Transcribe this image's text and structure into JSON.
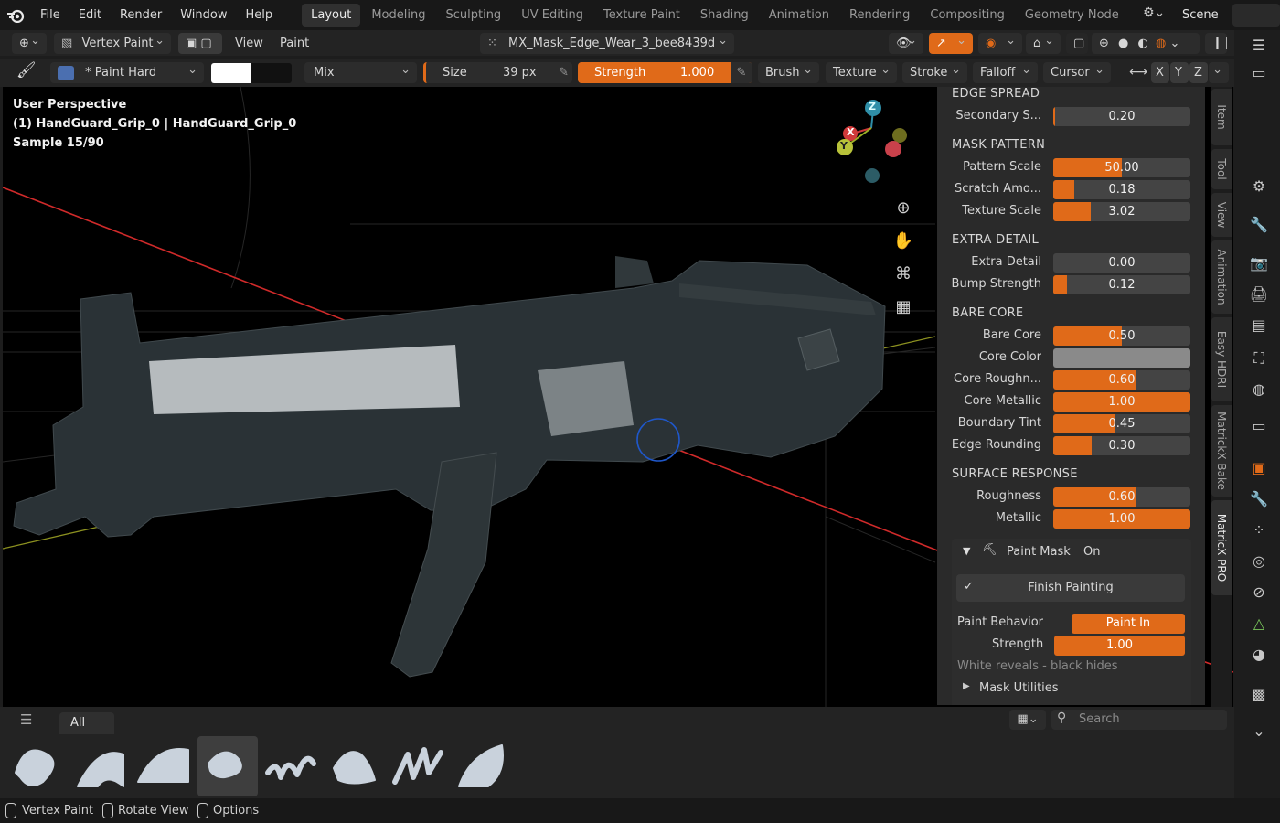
{
  "menu": [
    "File",
    "Edit",
    "Render",
    "Window",
    "Help"
  ],
  "workspaces": [
    {
      "label": "Layout",
      "active": true
    },
    {
      "label": "Modeling",
      "active": false
    },
    {
      "label": "Sculpting",
      "active": false
    },
    {
      "label": "UV Editing",
      "active": false
    },
    {
      "label": "Texture Paint",
      "active": false
    },
    {
      "label": "Shading",
      "active": false
    },
    {
      "label": "Animation",
      "active": false
    },
    {
      "label": "Rendering",
      "active": false
    },
    {
      "label": "Compositing",
      "active": false
    },
    {
      "label": "Geometry Node",
      "active": false
    }
  ],
  "scene": "Scene",
  "header1": {
    "mode": "Vertex Paint",
    "view": "View",
    "paint": "Paint",
    "color_attribute": "MX_Mask_Edge_Wear_3_bee8439d"
  },
  "header2": {
    "brush_name": "* Paint Hard",
    "blend": "Mix",
    "size_label": "Size",
    "size_value": "39 px",
    "strength_label": "Strength",
    "strength_value": "1.000",
    "brush": "Brush",
    "texture": "Texture",
    "stroke": "Stroke",
    "falloff": "Falloff",
    "cursor": "Cursor",
    "x": "X",
    "y": "Y",
    "z": "Z"
  },
  "viewport": {
    "perspective": "User Perspective",
    "object": "(1) HandGuard_Grip_0 | HandGuard_Grip_0",
    "sample": "Sample 15/90",
    "gizmo": {
      "x": "X",
      "y": "Y",
      "z": "Z"
    }
  },
  "panel": {
    "sections": [
      {
        "title": "EDGE SPREAD",
        "rows": [
          {
            "label": "Secondary S...",
            "value": "0.20",
            "fraction": 0.01
          }
        ]
      },
      {
        "title": "MASK PATTERN",
        "rows": [
          {
            "label": "Pattern Scale",
            "value": "50.00",
            "fraction": 0.5
          },
          {
            "label": "Scratch Amo...",
            "value": "0.18",
            "fraction": 0.15
          },
          {
            "label": "Texture Scale",
            "value": "3.02",
            "fraction": 0.27
          }
        ]
      },
      {
        "title": "EXTRA DETAIL",
        "rows": [
          {
            "label": "Extra Detail",
            "value": "0.00",
            "fraction": 0.0
          },
          {
            "label": "Bump Strength",
            "value": "0.12",
            "fraction": 0.1
          }
        ]
      },
      {
        "title": "BARE CORE",
        "rows": [
          {
            "label": "Bare Core",
            "value": "0.50",
            "fraction": 0.5
          },
          {
            "label": "Core Color",
            "value": "",
            "fraction": 0,
            "swatch": "#8a8a8a"
          },
          {
            "label": "Core Roughn...",
            "value": "0.60",
            "fraction": 0.6
          },
          {
            "label": "Core Metallic",
            "value": "1.00",
            "fraction": 1.0
          },
          {
            "label": "Boundary Tint",
            "value": "0.45",
            "fraction": 0.45
          },
          {
            "label": "Edge Rounding",
            "value": "0.30",
            "fraction": 0.28
          }
        ]
      },
      {
        "title": "SURFACE RESPONSE",
        "rows": [
          {
            "label": "Roughness",
            "value": "0.60",
            "fraction": 0.6
          },
          {
            "label": "Metallic",
            "value": "1.00",
            "fraction": 1.0
          }
        ]
      }
    ],
    "paint_mask_label": "Paint Mask",
    "paint_mask_state": "On",
    "finish_painting": "Finish Painting",
    "paint_behavior_label": "Paint Behavior",
    "paint_behavior_value": "Paint In",
    "strength_label": "Strength",
    "strength_value": "1.00",
    "hint": "White reveals - black hides",
    "mask_utilities": "Mask Utilities"
  },
  "vertical_tabs": [
    "Item",
    "Tool",
    "View",
    "Animation",
    "Easy HDRI",
    "MatrickX Bake",
    "MatricX PRO"
  ],
  "shelf": {
    "filter": "All",
    "search_placeholder": "Search"
  },
  "status": {
    "left": "Vertex Paint",
    "middle": "Rotate View",
    "right": "Options"
  },
  "colors": {
    "accent": "#e06a19",
    "selection_circle": "#1f57c9",
    "axis_x": "#e23a3a",
    "axis_y": "#9db025",
    "axis_z": "#2f8fa8"
  }
}
